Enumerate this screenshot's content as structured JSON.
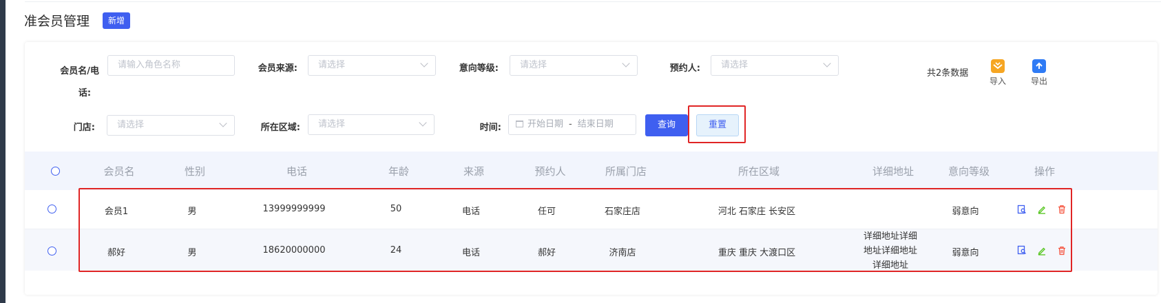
{
  "page": {
    "title": "准会员管理",
    "add_label": "新增"
  },
  "filters": {
    "member_label_line1": "会员名/电",
    "member_label_line2": "话:",
    "member_placeholder": "请输入角色名称",
    "source_label": "会员来源:",
    "source_value": "请选择",
    "intent_label": "意向等级:",
    "intent_value": "请选择",
    "booker_label": "预约人:",
    "booker_value": "请选择",
    "store_label": "门店:",
    "store_value": "请选择",
    "region_label": "所在区域:",
    "region_value": "请选择",
    "time_label": "时间:",
    "date_start_placeholder": "开始日期",
    "date_sep": "-",
    "date_end_placeholder": "结束日期",
    "query_label": "查询",
    "reset_label": "重置"
  },
  "summary": {
    "total": "共2条数据",
    "import_label": "导入",
    "export_label": "导出"
  },
  "table": {
    "headers": [
      "会员名",
      "性别",
      "电话",
      "年龄",
      "来源",
      "预约人",
      "所属门店",
      "所在区域",
      "详细地址",
      "意向等级",
      "操作"
    ],
    "rows": [
      {
        "name": "会员1",
        "gender": "男",
        "phone": "13999999999",
        "age": "50",
        "source": "电话",
        "booker": "任可",
        "store": "石家庄店",
        "region": "河北 石家庄 长安区",
        "address_line1": "",
        "address_line2": "",
        "address_line3": "",
        "intent": "弱意向"
      },
      {
        "name": "郝好",
        "gender": "男",
        "phone": "18620000000",
        "age": "24",
        "source": "电话",
        "booker": "郝好",
        "store": "济南店",
        "region": "重庆 重庆 大渡口区",
        "address_line1": "详细地址详细",
        "address_line2": "地址详细地址",
        "address_line3": "详细地址",
        "intent": "弱意向"
      }
    ]
  },
  "colors": {
    "primary": "#3f5ff0",
    "highlight": "#e02424",
    "edit_icon": "#52c41a",
    "delete_icon": "#f5533d",
    "import_icon": "#f6a623",
    "export_icon": "#2f7bf5"
  },
  "icons": [
    "calendar-icon",
    "chevron-down-icon",
    "import-icon",
    "export-icon",
    "view-icon",
    "edit-icon",
    "delete-icon"
  ]
}
